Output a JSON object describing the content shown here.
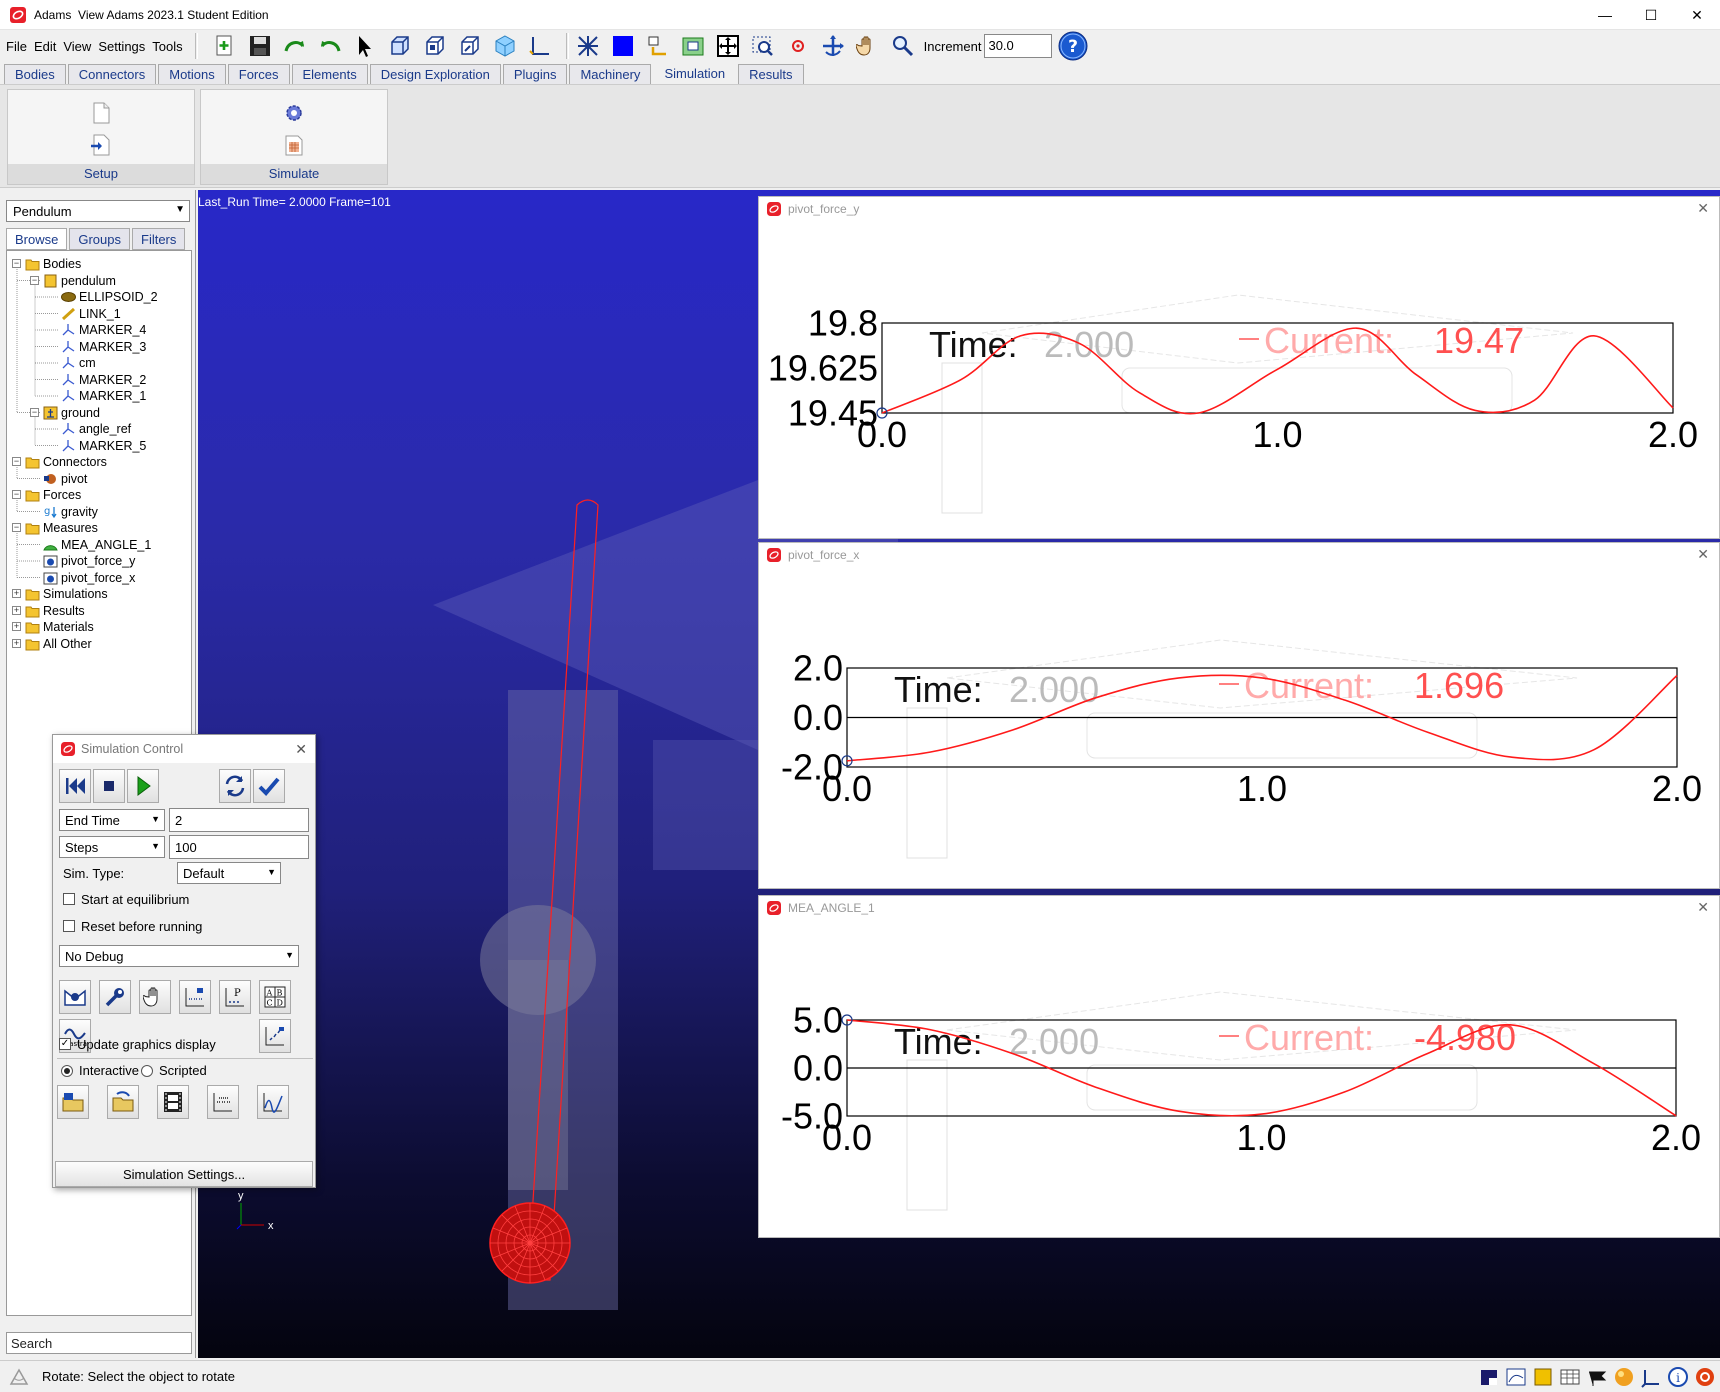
{
  "window": {
    "app_name": "Adams",
    "title": "View Adams 2023.1 Student Edition",
    "minimize": "—",
    "maximize": "☐",
    "close": "✕"
  },
  "menu": [
    "File",
    "Edit",
    "View",
    "Settings",
    "Tools"
  ],
  "toolbar": {
    "icons": [
      "new-model-icon",
      "save-icon",
      "redo-icon",
      "undo-icon",
      "select-arrow-icon",
      "front-view-icon",
      "iso-view-icon",
      "right-view-icon",
      "3d-box-icon",
      "coordinate-axes-icon",
      "mesh-icon",
      "solid-color-icon",
      "rotate-view-icon",
      "fit-icon",
      "zoom-window-icon",
      "center-icon",
      "target-icon",
      "translate-icon",
      "pan-hand-icon",
      "zoom-icon"
    ],
    "increment_label": "Increment",
    "increment_value": "30.0"
  },
  "tabs": [
    "Bodies",
    "Connectors",
    "Motions",
    "Forces",
    "Elements",
    "Design Exploration",
    "Plugins",
    "Machinery",
    "Simulation",
    "Results"
  ],
  "active_tab": "Simulation",
  "ribbon": {
    "groups": [
      "Setup",
      "Simulate"
    ]
  },
  "model_browser": {
    "model": "Pendulum",
    "subtabs": [
      "Browse",
      "Groups",
      "Filters"
    ],
    "tree": [
      {
        "label": "Bodies",
        "level": 0,
        "icon": "folder"
      },
      {
        "label": "pendulum",
        "level": 1,
        "icon": "body"
      },
      {
        "label": "ELLIPSOID_2",
        "level": 2,
        "icon": "ellipsoid"
      },
      {
        "label": "LINK_1",
        "level": 2,
        "icon": "link"
      },
      {
        "label": "MARKER_4",
        "level": 2,
        "icon": "marker"
      },
      {
        "label": "MARKER_3",
        "level": 2,
        "icon": "marker"
      },
      {
        "label": "cm",
        "level": 2,
        "icon": "marker"
      },
      {
        "label": "MARKER_2",
        "level": 2,
        "icon": "marker"
      },
      {
        "label": "MARKER_1",
        "level": 2,
        "icon": "marker"
      },
      {
        "label": "ground",
        "level": 1,
        "icon": "ground"
      },
      {
        "label": "angle_ref",
        "level": 2,
        "icon": "marker"
      },
      {
        "label": "MARKER_5",
        "level": 2,
        "icon": "marker"
      },
      {
        "label": "Connectors",
        "level": 0,
        "icon": "folder"
      },
      {
        "label": "pivot",
        "level": 1,
        "icon": "joint"
      },
      {
        "label": "Forces",
        "level": 0,
        "icon": "folder"
      },
      {
        "label": "gravity",
        "level": 1,
        "icon": "gravity"
      },
      {
        "label": "Measures",
        "level": 0,
        "icon": "folder"
      },
      {
        "label": "MEA_ANGLE_1",
        "level": 1,
        "icon": "angle"
      },
      {
        "label": "pivot_force_y",
        "level": 1,
        "icon": "measure"
      },
      {
        "label": "pivot_force_x",
        "level": 1,
        "icon": "measure"
      },
      {
        "label": "Simulations",
        "level": 0,
        "icon": "folder"
      },
      {
        "label": "Results",
        "level": 0,
        "icon": "folder"
      },
      {
        "label": "Materials",
        "level": 0,
        "icon": "folder"
      },
      {
        "label": "All Other",
        "level": 0,
        "icon": "folder"
      }
    ],
    "search_label": "Search"
  },
  "viewport": {
    "run_info": "Last_Run   Time= 2.0000  Frame=101",
    "triad_y": "y",
    "triad_x": "x",
    "pendulum_color": "#ff2020"
  },
  "plots": [
    {
      "title": "pivot_force_y",
      "time_label": "Time:",
      "time_value": "2.000",
      "current_label": "Current:",
      "current_value": "19.47",
      "y_ticks": [
        "19.8",
        "19.625",
        "19.45"
      ],
      "x_ticks": [
        "0.0",
        "1.0",
        "2.0"
      ]
    },
    {
      "title": "pivot_force_x",
      "time_label": "Time:",
      "time_value": "2.000",
      "current_label": "Current:",
      "current_value": "1.696",
      "y_ticks": [
        "2.0",
        "0.0",
        "-2.0"
      ],
      "x_ticks": [
        "0.0",
        "1.0",
        "2.0"
      ]
    },
    {
      "title": "MEA_ANGLE_1",
      "time_label": "Time:",
      "time_value": "2.000",
      "current_label": "Current:",
      "current_value": "-4.980",
      "y_ticks": [
        "5.0",
        "0.0",
        "-5.0"
      ],
      "x_ticks": [
        "0.0",
        "1.0",
        "2.0"
      ]
    }
  ],
  "chart_data": [
    {
      "type": "line",
      "series": [
        {
          "x": [
            0.0,
            0.2,
            0.35,
            0.5,
            0.65,
            0.8,
            1.0,
            1.2,
            1.35,
            1.5,
            1.65,
            1.8,
            2.0
          ],
          "values": [
            19.45,
            19.58,
            19.75,
            19.72,
            19.53,
            19.45,
            19.62,
            19.78,
            19.6,
            19.46,
            19.5,
            19.75,
            19.47
          ]
        }
      ],
      "xlim": [
        0.0,
        2.0
      ],
      "ylim": [
        19.45,
        19.8
      ]
    },
    {
      "type": "line",
      "series": [
        {
          "x": [
            0.0,
            0.2,
            0.4,
            0.6,
            0.8,
            1.0,
            1.2,
            1.4,
            1.6,
            1.8,
            2.0
          ],
          "values": [
            -1.75,
            -1.4,
            -0.5,
            0.8,
            1.6,
            1.6,
            0.7,
            -0.6,
            -1.6,
            -1.3,
            1.696
          ]
        }
      ],
      "xlim": [
        0.0,
        2.0
      ],
      "ylim": [
        -2.0,
        2.0
      ]
    },
    {
      "type": "line",
      "series": [
        {
          "x": [
            0.0,
            0.2,
            0.4,
            0.6,
            0.8,
            1.0,
            1.2,
            1.4,
            1.6,
            1.8,
            2.0
          ],
          "values": [
            5.0,
            4.0,
            1.5,
            -2.0,
            -4.5,
            -4.8,
            -2.5,
            1.5,
            4.5,
            0.5,
            -4.98
          ]
        }
      ],
      "xlim": [
        0.0,
        2.0
      ],
      "ylim": [
        -5.0,
        5.0
      ]
    }
  ],
  "sim_control": {
    "title": "Simulation Control",
    "end_time_label": "End Time",
    "end_time_value": "2",
    "steps_label": "Steps",
    "steps_value": "100",
    "sim_type_label": "Sim. Type:",
    "sim_type_value": "Default",
    "start_equilibrium": "Start at equilibrium",
    "reset_before": "Reset before running",
    "debug_value": "No Debug",
    "update_graphics": "Update graphics display",
    "interactive": "Interactive",
    "scripted": "Scripted",
    "settings_button": "Simulation Settings..."
  },
  "status": {
    "text": "Rotate: Select the object to rotate"
  }
}
